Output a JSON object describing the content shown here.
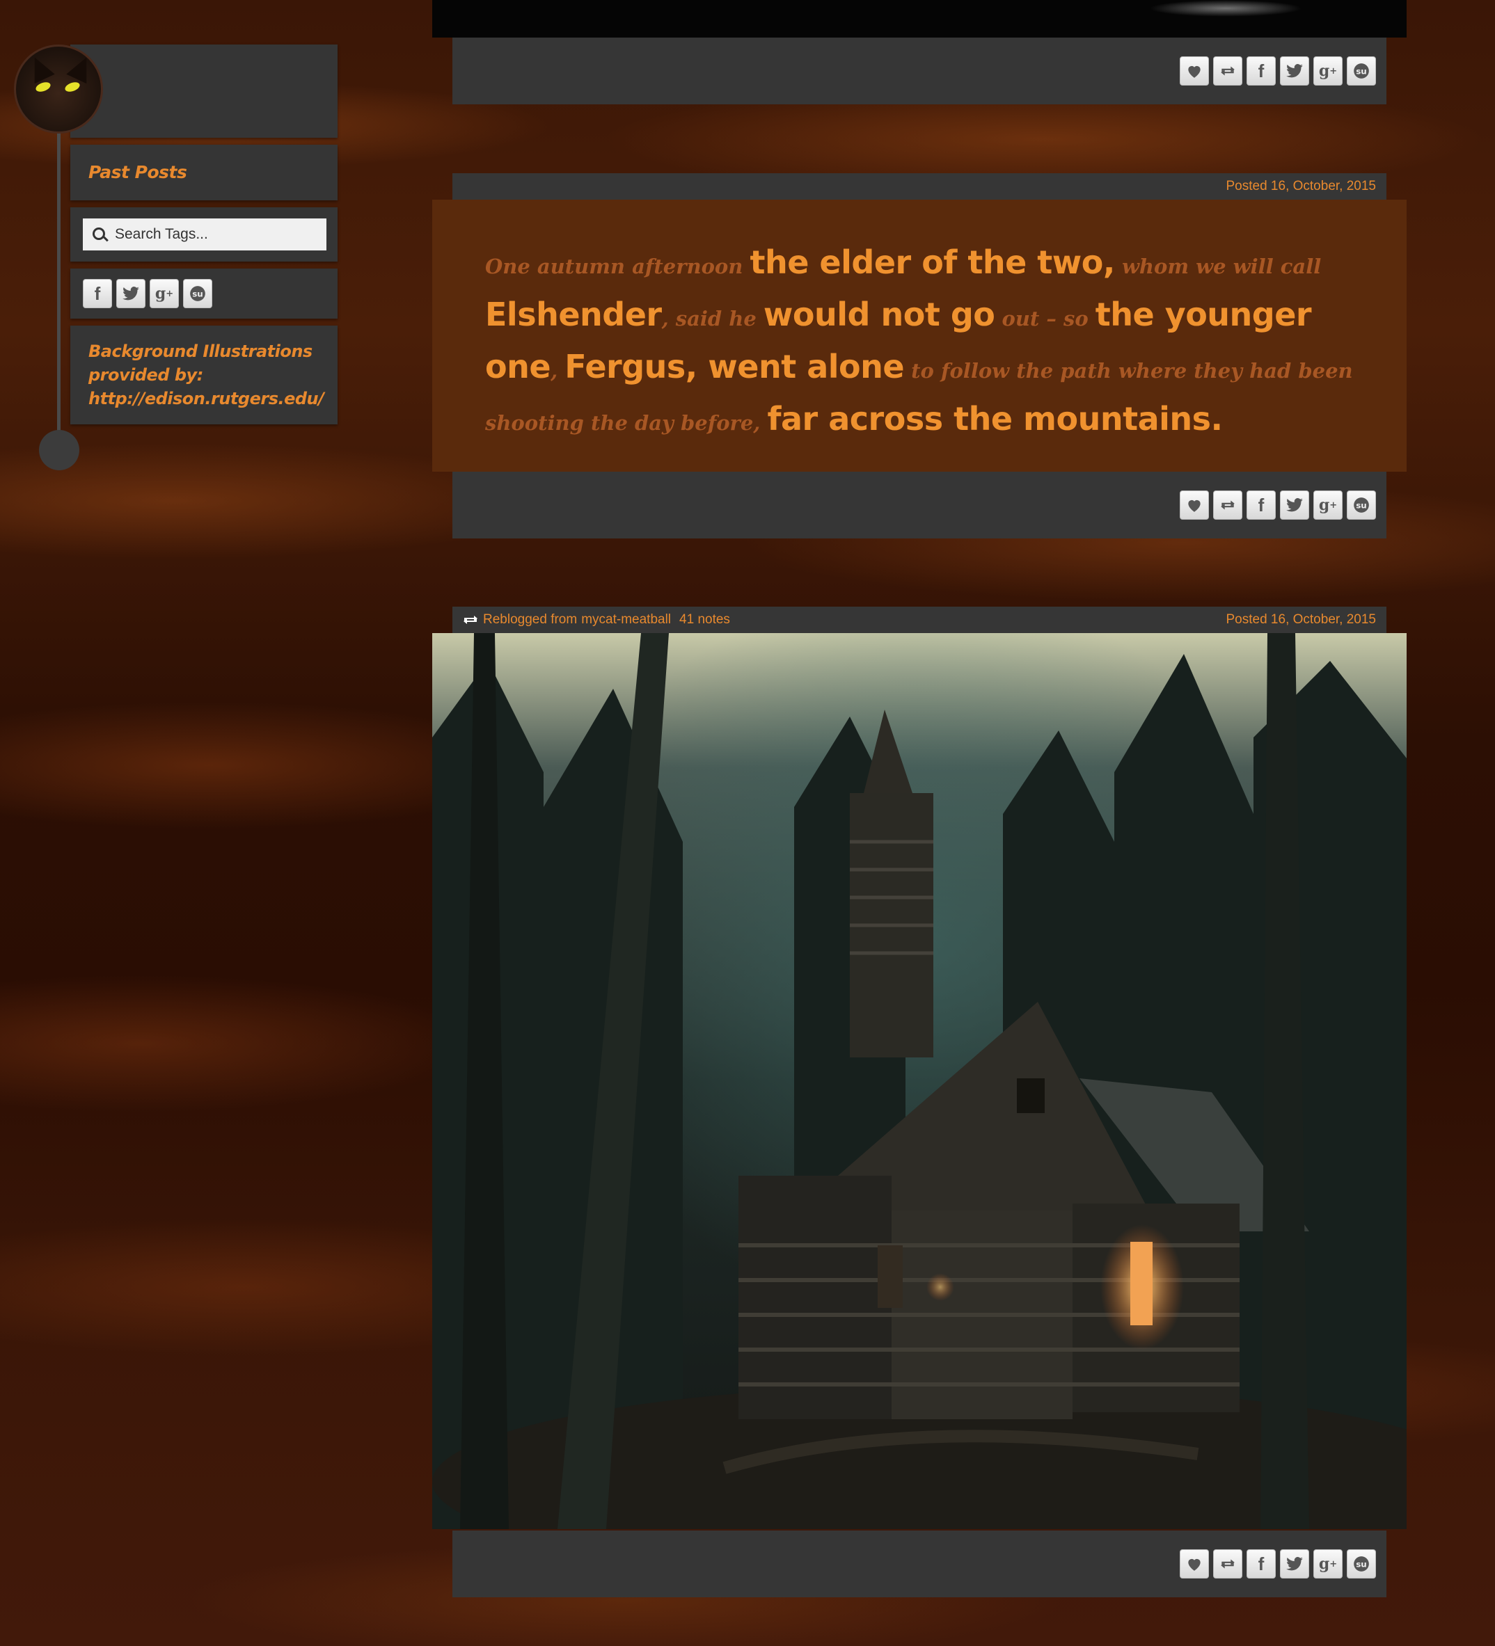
{
  "sidebar": {
    "past_posts": "Past Posts",
    "search_placeholder": "Search Tags...",
    "credits": "Background Illustrations provided by: http://edison.rutgers.edu/",
    "social_icons": [
      "facebook-icon",
      "twitter-icon",
      "google-plus-icon",
      "stumbleupon-icon"
    ]
  },
  "posts": [
    {
      "type": "image",
      "actions": [
        "like-icon",
        "reblog-icon",
        "facebook-icon",
        "twitter-icon",
        "google-plus-icon",
        "stumbleupon-icon"
      ]
    },
    {
      "type": "quote",
      "date": "Posted 16, October, 2015",
      "quote_parts": [
        {
          "text": "One autumn afternoon ",
          "style": "small"
        },
        {
          "text": "the elder of the two,",
          "style": "big"
        },
        {
          "text": " whom we will call ",
          "style": "small"
        },
        {
          "text": "Elshender",
          "style": "big"
        },
        {
          "text": ", said he ",
          "style": "small"
        },
        {
          "text": "would not go",
          "style": "big"
        },
        {
          "text": " out – so ",
          "style": "small"
        },
        {
          "text": "the younger one",
          "style": "big"
        },
        {
          "text": ", ",
          "style": "small"
        },
        {
          "text": "Fergus, went alone",
          "style": "big"
        },
        {
          "text": " to follow the path where they had been shooting the day before, ",
          "style": "small"
        },
        {
          "text": "far across the mountains.",
          "style": "big"
        }
      ]
    },
    {
      "type": "photo",
      "reblog_prefix": "Reblogged from",
      "reblog_source": "mycat-meatball",
      "notes": "41 notes",
      "date": "Posted 16, October, 2015"
    }
  ],
  "colors": {
    "accent": "#e8892e",
    "panel": "#353535",
    "quote_bg": "#5a2a0c"
  }
}
